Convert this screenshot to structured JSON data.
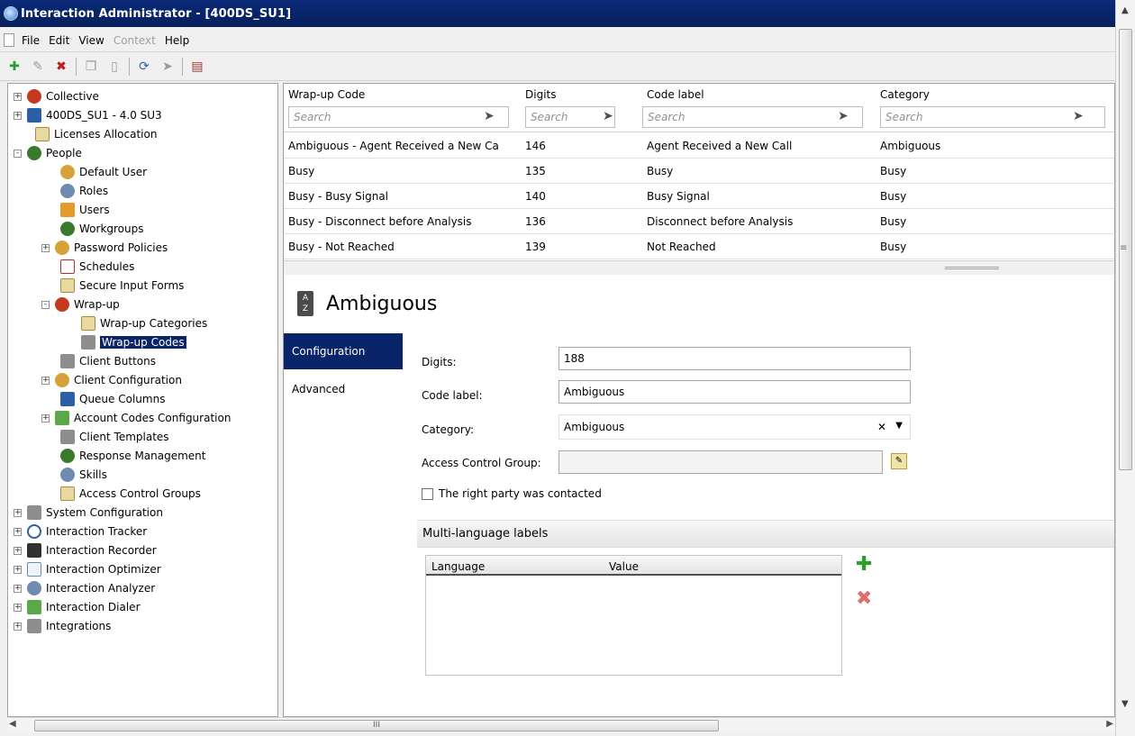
{
  "window": {
    "title": "Interaction Administrator - [400DS_SU1]"
  },
  "menu": [
    "File",
    "Edit",
    "View",
    "Context",
    "Help"
  ],
  "toolbar": {
    "buttons": [
      "new-icon",
      "edit-icon",
      "delete-icon",
      "copy-icon",
      "paste-icon",
      "refresh-icon",
      "filter-icon",
      "properties-icon"
    ]
  },
  "tree": [
    {
      "label": "Collective",
      "level": 0,
      "expander": "+"
    },
    {
      "label": "400DS_SU1 - 4.0 SU3",
      "level": 0,
      "expander": "+"
    },
    {
      "label": "Licenses Allocation",
      "level": 1,
      "expander": ""
    },
    {
      "label": "People",
      "level": 0,
      "expander": "-"
    },
    {
      "label": "Default User",
      "level": 1,
      "expander": ""
    },
    {
      "label": "Roles",
      "level": 1,
      "expander": ""
    },
    {
      "label": "Users",
      "level": 1,
      "expander": ""
    },
    {
      "label": "Workgroups",
      "level": 1,
      "expander": ""
    },
    {
      "label": "Password Policies",
      "level": 1,
      "expander": "+"
    },
    {
      "label": "Schedules",
      "level": 1,
      "expander": ""
    },
    {
      "label": "Secure Input Forms",
      "level": 1,
      "expander": ""
    },
    {
      "label": "Wrap-up",
      "level": 1,
      "expander": "-"
    },
    {
      "label": "Wrap-up Categories",
      "level": 2,
      "expander": ""
    },
    {
      "label": "Wrap-up Codes",
      "level": 2,
      "expander": "",
      "selected": true
    },
    {
      "label": "Client Buttons",
      "level": 1,
      "expander": ""
    },
    {
      "label": "Client Configuration",
      "level": 1,
      "expander": "+"
    },
    {
      "label": "Queue Columns",
      "level": 1,
      "expander": ""
    },
    {
      "label": "Account Codes Configuration",
      "level": 1,
      "expander": "+"
    },
    {
      "label": "Client Templates",
      "level": 1,
      "expander": ""
    },
    {
      "label": "Response Management",
      "level": 1,
      "expander": ""
    },
    {
      "label": "Skills",
      "level": 1,
      "expander": ""
    },
    {
      "label": "Access Control Groups",
      "level": 1,
      "expander": ""
    },
    {
      "label": "System Configuration",
      "level": 0,
      "expander": "+"
    },
    {
      "label": "Interaction Tracker",
      "level": 0,
      "expander": "+"
    },
    {
      "label": "Interaction Recorder",
      "level": 0,
      "expander": "+"
    },
    {
      "label": "Interaction Optimizer",
      "level": 0,
      "expander": "+"
    },
    {
      "label": "Interaction Analyzer",
      "level": 0,
      "expander": "+"
    },
    {
      "label": "Interaction Dialer",
      "level": 0,
      "expander": "+"
    },
    {
      "label": "Integrations",
      "level": 0,
      "expander": "+"
    }
  ],
  "grid": {
    "columns": [
      "Wrap-up Code",
      "Digits",
      "Code label",
      "Category"
    ],
    "search_placeholder": "Search",
    "rows": [
      [
        "Ambiguous - Agent Received a New Ca",
        "146",
        "Agent Received a New Call",
        "Ambiguous"
      ],
      [
        "Busy",
        "135",
        "Busy",
        "Busy"
      ],
      [
        "Busy - Busy Signal",
        "140",
        "Busy Signal",
        "Busy"
      ],
      [
        "Busy - Disconnect before Analysis",
        "136",
        "Disconnect before Analysis",
        "Busy"
      ],
      [
        "Busy - Not Reached",
        "139",
        "Not Reached",
        "Busy"
      ]
    ]
  },
  "detail": {
    "title": "Ambiguous",
    "tabs": [
      "Configuration",
      "Advanced"
    ],
    "active_tab": "Configuration",
    "fields": {
      "digits_label": "Digits:",
      "digits_value": "188",
      "code_label_label": "Code label:",
      "code_label_value": "Ambiguous",
      "category_label": "Category:",
      "category_value": "Ambiguous",
      "acg_label": "Access Control Group:",
      "acg_value": "",
      "right_party_label": "The right party was contacted",
      "right_party_checked": false
    },
    "multilang": {
      "header": "Multi-language labels",
      "columns": [
        "Language",
        "Value"
      ]
    }
  },
  "scrollbar": {
    "h_grip": "III"
  }
}
